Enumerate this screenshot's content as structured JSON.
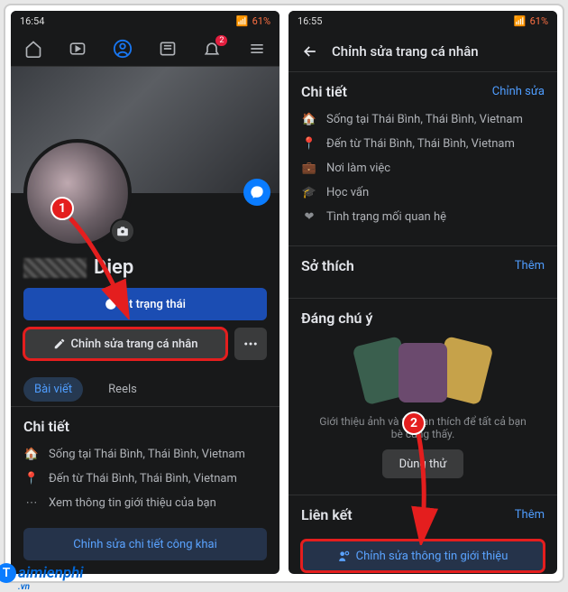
{
  "phone1": {
    "status": {
      "time": "16:54",
      "battery": "61%"
    },
    "name_visible": "Diep",
    "buttons": {
      "status_label": "ặt trạng thái",
      "edit_profile": "Chỉnh sửa trang cá nhân"
    },
    "tabs": {
      "posts": "Bài viết",
      "reels": "Reels"
    },
    "details": {
      "title": "Chi tiết",
      "lives": "Sống tại Thái Bình, Thái Bình, Vietnam",
      "from": "Đến từ Thái Bình, Thái Bình, Vietnam",
      "see_intro": "Xem thông tin giới thiệu của bạn",
      "edit_public": "Chỉnh sửa chi tiết công khai"
    }
  },
  "phone2": {
    "status": {
      "time": "16:55",
      "battery": "61%"
    },
    "header": "Chỉnh sửa trang cá nhân",
    "details": {
      "title": "Chi tiết",
      "edit": "Chỉnh sửa",
      "lives": "Sống tại Thái Bình, Thái Bình, Vietnam",
      "from": "Đến từ Thái Bình, Thái Bình, Vietnam",
      "work": "Nơi làm việc",
      "edu": "Học vấn",
      "rel": "Tình trạng mối quan hệ"
    },
    "hobbies": {
      "title": "Sở thích",
      "add": "Thêm"
    },
    "featured": {
      "title": "Đáng chú ý",
      "desc": "Giới thiệu ảnh và tin bạn thích để tất cả bạn bè cùng thấy.",
      "try": "Dùng thử"
    },
    "links": {
      "title": "Liên kết",
      "add": "Thêm",
      "edit_about": "Chỉnh sửa thông tin giới thiệu"
    }
  },
  "notif_badge": "2",
  "watermark": {
    "text": "aimienphi",
    "sub": ".vn"
  }
}
